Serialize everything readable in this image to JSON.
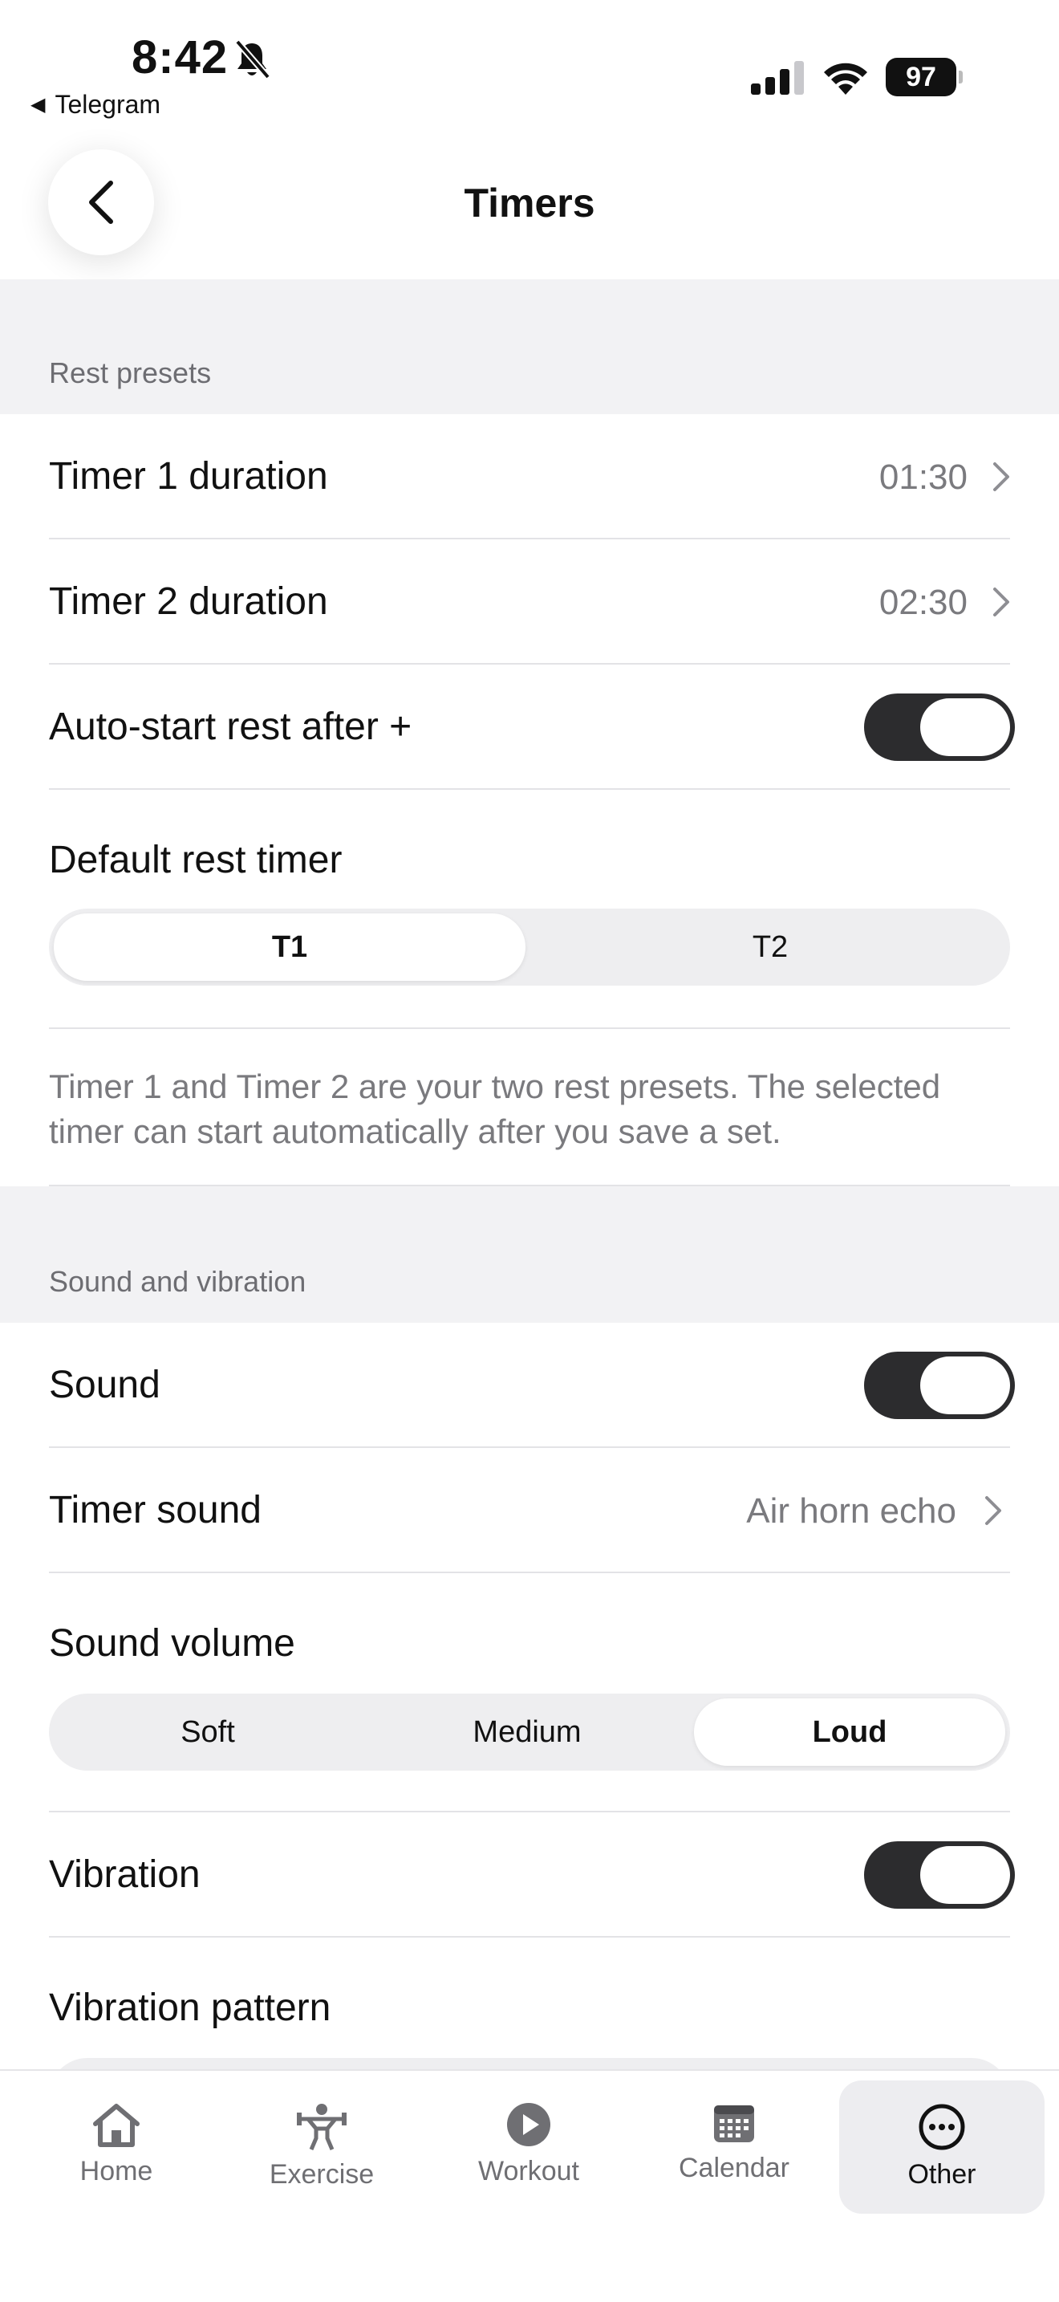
{
  "status_bar": {
    "time": "8:42",
    "back_app": "Telegram",
    "battery": "97"
  },
  "header": {
    "title": "Timers"
  },
  "rest_presets": {
    "section_label": "Rest presets",
    "timer1": {
      "label": "Timer 1 duration",
      "value": "01:30"
    },
    "timer2": {
      "label": "Timer 2 duration",
      "value": "02:30"
    },
    "auto_start": {
      "label": "Auto-start rest after +",
      "on": true
    },
    "default_timer": {
      "label": "Default rest timer",
      "options": [
        "T1",
        "T2"
      ],
      "selected": "T1"
    },
    "note": "Timer 1 and Timer 2 are your two rest presets. The selected timer can start automatically after you save a set."
  },
  "sound_vibration": {
    "section_label": "Sound and vibration",
    "sound": {
      "label": "Sound",
      "on": true
    },
    "timer_sound": {
      "label": "Timer sound",
      "value": "Air horn echo"
    },
    "volume": {
      "label": "Sound volume",
      "options": [
        "Soft",
        "Medium",
        "Loud"
      ],
      "selected": "Loud"
    },
    "vibration": {
      "label": "Vibration",
      "on": true
    },
    "vibration_pattern": {
      "label": "Vibration pattern"
    }
  },
  "tabbar": {
    "items": [
      {
        "label": "Home",
        "icon": "home-icon"
      },
      {
        "label": "Exercise",
        "icon": "weightlifter-icon"
      },
      {
        "label": "Workout",
        "icon": "play-circle-icon"
      },
      {
        "label": "Calendar",
        "icon": "calendar-icon"
      },
      {
        "label": "Other",
        "icon": "more-circle-icon"
      }
    ],
    "active": "Other"
  }
}
